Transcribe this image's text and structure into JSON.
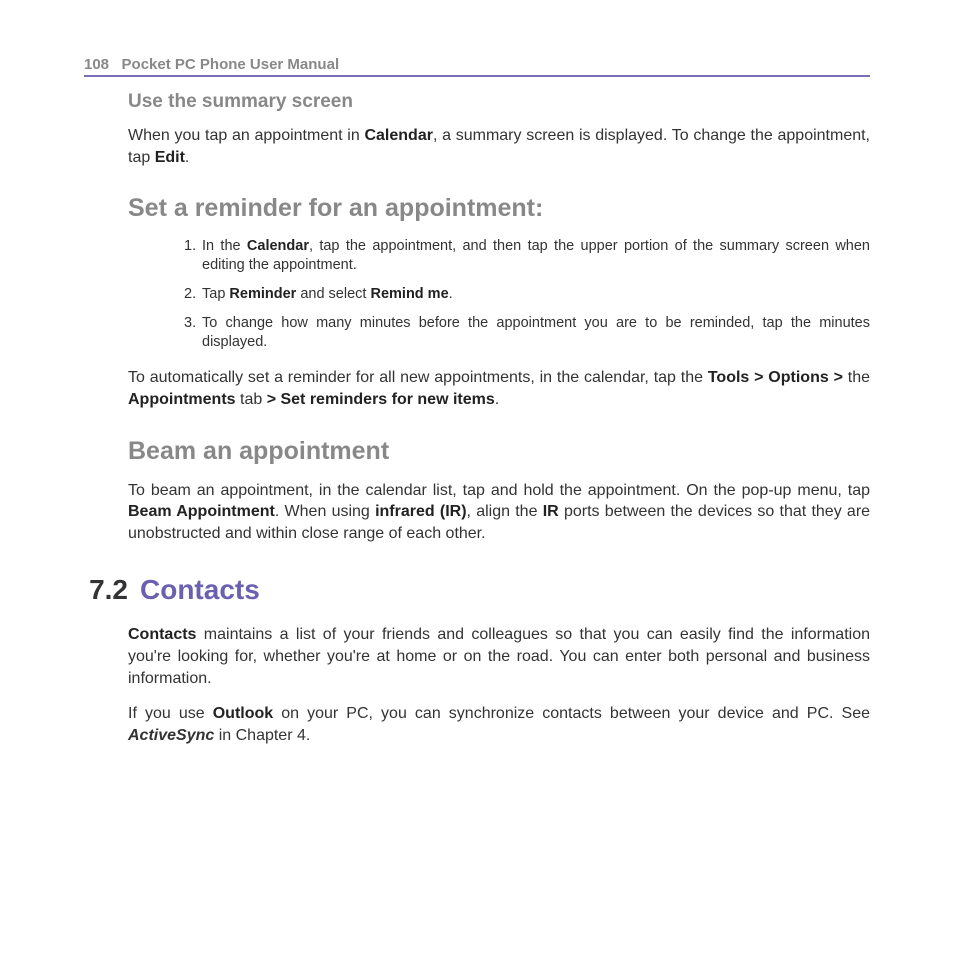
{
  "header": {
    "page_number": "108",
    "manual_title": "Pocket PC Phone User Manual"
  },
  "sec1": {
    "heading": "Use the summary screen",
    "p1_a": "When you tap an appointment in ",
    "p1_b1": "Calendar",
    "p1_c": ", a summary screen is displayed. To change the appointment, tap ",
    "p1_b2": "Edit",
    "p1_d": "."
  },
  "sec2": {
    "heading": "Set a reminder for an appointment:",
    "li1_a": "In the ",
    "li1_b": "Calendar",
    "li1_c": ", tap the appointment, and then tap the upper portion of the summary screen when editing the appointment.",
    "li2_a": "Tap ",
    "li2_b": "Reminder",
    "li2_c": " and select ",
    "li2_d": "Remind me",
    "li2_e": ".",
    "li3": "To change how many minutes before the appointment you are to be reminded, tap the minutes displayed.",
    "p_a": "To automatically set a reminder for all new appointments, in the calendar, tap the ",
    "p_b1": "Tools > Options > ",
    "p_c": "the ",
    "p_b2": "Appointments",
    "p_d": " tab ",
    "p_b3": "> Set reminders for new items",
    "p_e": "."
  },
  "sec3": {
    "heading": "Beam an appointment",
    "p_a": "To beam an appointment, in the calendar list, tap and hold the appointment. On the pop-up menu, tap ",
    "p_b1": "Beam Appointment",
    "p_c": ". When using ",
    "p_b2": "infrared (IR)",
    "p_d": ", align the ",
    "p_b3": "IR",
    "p_e": " ports between the devices so that they are unobstructed and within close range of each other."
  },
  "chapter": {
    "num": "7.2",
    "title": "Contacts"
  },
  "sec4": {
    "p1_b": "Contacts",
    "p1_a": " maintains a list of your friends and colleagues so that you can easily find the information you're looking for, whether you're at home or on the road. You can enter both personal and business information.",
    "p2_a": "If you use ",
    "p2_b1": "Outlook",
    "p2_c": " on your PC, you can synchronize contacts between your device and PC. See ",
    "p2_b2": "ActiveSync",
    "p2_d": " in Chapter 4."
  }
}
